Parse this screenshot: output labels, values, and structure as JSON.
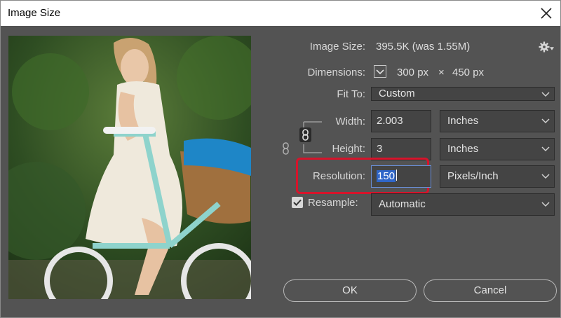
{
  "window": {
    "title": "Image Size"
  },
  "info": {
    "image_size_label": "Image Size:",
    "image_size_value": "395.5K (was 1.55M)",
    "dimensions_label": "Dimensions:",
    "dim_width": "300 px",
    "dim_times": "×",
    "dim_height": "450 px"
  },
  "fit_to": {
    "label": "Fit To:",
    "value": "Custom"
  },
  "width": {
    "label": "Width:",
    "value": "2.003",
    "unit": "Inches"
  },
  "height": {
    "label": "Height:",
    "value": "3",
    "unit": "Inches"
  },
  "resolution": {
    "label": "Resolution:",
    "value": "150",
    "unit": "Pixels/Inch"
  },
  "resample": {
    "label": "Resample:",
    "value": "Automatic",
    "checked": true
  },
  "buttons": {
    "ok": "OK",
    "cancel": "Cancel"
  },
  "colors": {
    "dialog_bg": "#535353",
    "field_bg": "#444444",
    "highlight": "#d6142b",
    "selection": "#2f66c9"
  }
}
